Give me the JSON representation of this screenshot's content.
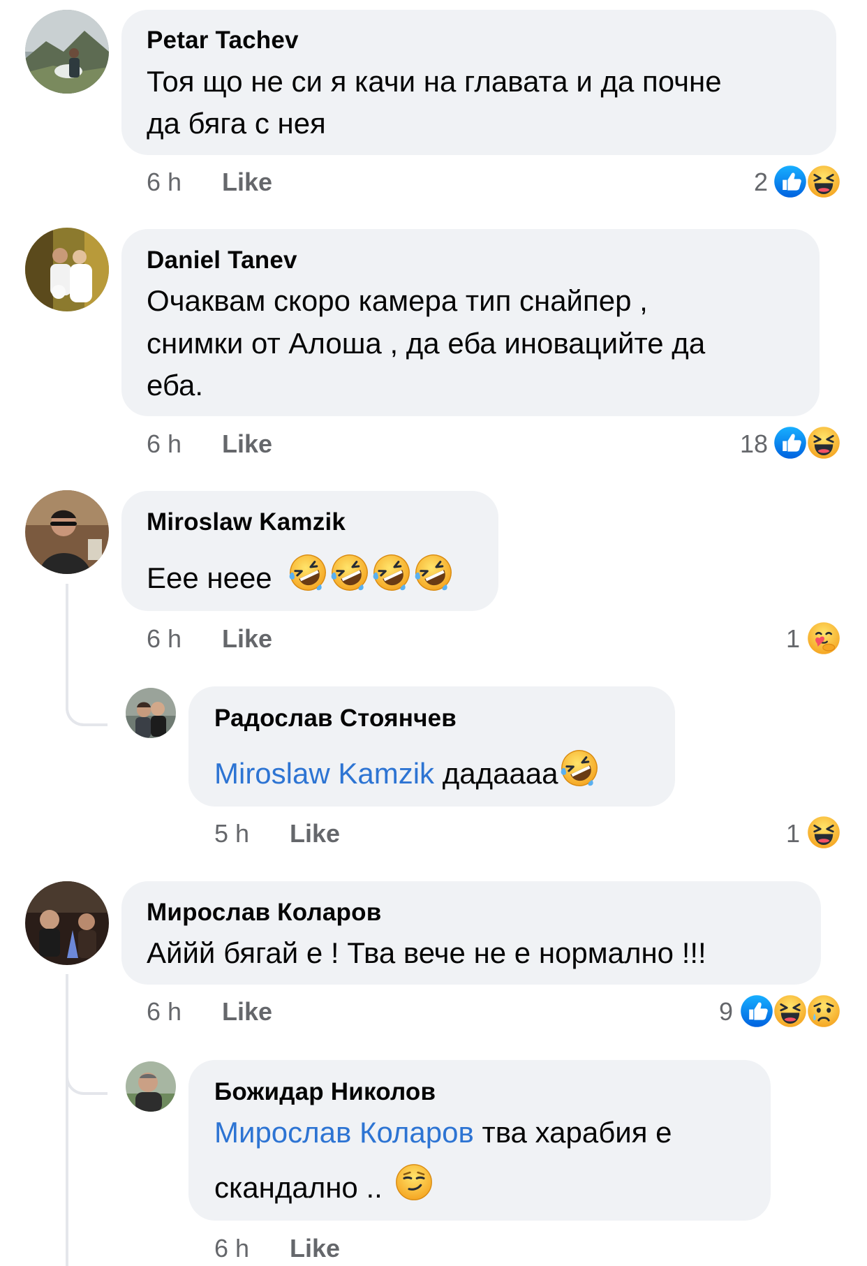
{
  "comments": [
    {
      "author": "Petar Tachev",
      "lines": [
        "Тоя що не си я качи на главата и да почне",
        "да бяга с нея"
      ],
      "time": "6 h",
      "like": "Like",
      "reaction_count": "2",
      "reactions": [
        "like-icon",
        "laugh-icon"
      ]
    },
    {
      "author": "Daniel Tanev",
      "lines": [
        "Очаквам скоро камера тип снайпер ,",
        "снимки от Алоша , да еба иновацийте да",
        "еба."
      ],
      "time": "6 h",
      "like": "Like",
      "reaction_count": "18",
      "reactions": [
        "like-icon",
        "laugh-icon"
      ]
    },
    {
      "author": "Miroslaw Kamzik",
      "text": "Еее нeee",
      "emojis": [
        "rofl-emoji",
        "rofl-emoji",
        "rofl-emoji",
        "rofl-emoji"
      ],
      "time": "6 h",
      "like": "Like",
      "reaction_count": "1",
      "reactions": [
        "care-icon"
      ],
      "reply": {
        "author": "Радослав Стоянчев",
        "mention": "Miroslaw Kamzik",
        "text": " дадаааа",
        "emojis": [
          "rofl-emoji"
        ],
        "time": "5 h",
        "like": "Like",
        "reaction_count": "1",
        "reactions": [
          "laugh-icon"
        ]
      }
    },
    {
      "author": "Мирослав Коларов",
      "text": "Аййй бягай е ! Тва вече не е нормално !!!",
      "time": "6 h",
      "like": "Like",
      "reaction_count": "9",
      "reactions": [
        "like-icon",
        "laugh-icon",
        "sad-icon"
      ],
      "reply": {
        "author": "Божидар Николов",
        "mention": "Мирослав Коларов",
        "text": " тва харабия е",
        "line2": "скандално .. ",
        "emojis": [
          "smirk-emoji"
        ],
        "time": "6 h",
        "like": "Like"
      }
    }
  ],
  "colors": {
    "like": "#1877f2",
    "emoji": "#f7b125",
    "mention": "#2d74d3",
    "bubble": "#f0f2f5",
    "meta": "#65676b"
  }
}
